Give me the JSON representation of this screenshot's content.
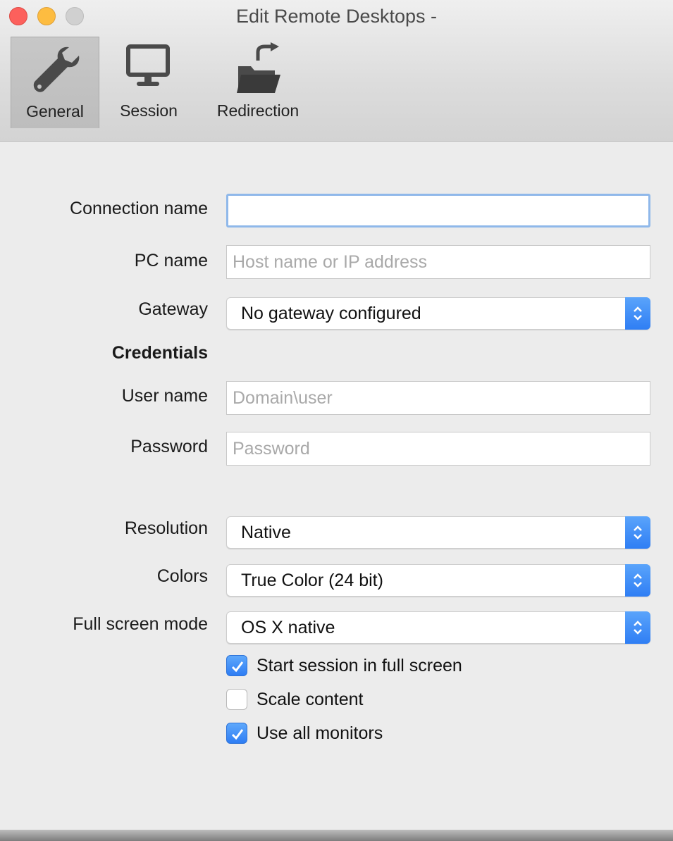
{
  "window": {
    "title": "Edit Remote Desktops -"
  },
  "toolbar": {
    "items": [
      {
        "label": "General",
        "icon": "wrench-icon",
        "selected": true
      },
      {
        "label": "Session",
        "icon": "monitor-icon",
        "selected": false
      },
      {
        "label": "Redirection",
        "icon": "folder-redirect-icon",
        "selected": false
      }
    ]
  },
  "form": {
    "connection_name": {
      "label": "Connection name",
      "value": "",
      "placeholder": ""
    },
    "pc_name": {
      "label": "PC name",
      "value": "",
      "placeholder": "Host name or IP address"
    },
    "gateway": {
      "label": "Gateway",
      "value": "No gateway configured"
    },
    "credentials_heading": "Credentials",
    "user_name": {
      "label": "User name",
      "value": "",
      "placeholder": "Domain\\user"
    },
    "password": {
      "label": "Password",
      "value": "",
      "placeholder": "Password"
    },
    "resolution": {
      "label": "Resolution",
      "value": "Native"
    },
    "colors": {
      "label": "Colors",
      "value": "True Color (24 bit)"
    },
    "full_screen_mode": {
      "label": "Full screen mode",
      "value": "OS X native"
    },
    "checkboxes": [
      {
        "label": "Start session in full screen",
        "checked": true
      },
      {
        "label": "Scale content",
        "checked": false
      },
      {
        "label": "Use all monitors",
        "checked": true
      }
    ]
  },
  "colors": {
    "accent": "#3b8cf6",
    "close": "#fc605c",
    "minimize": "#fdbc40",
    "zoom_disabled": "#d0d0d0"
  }
}
